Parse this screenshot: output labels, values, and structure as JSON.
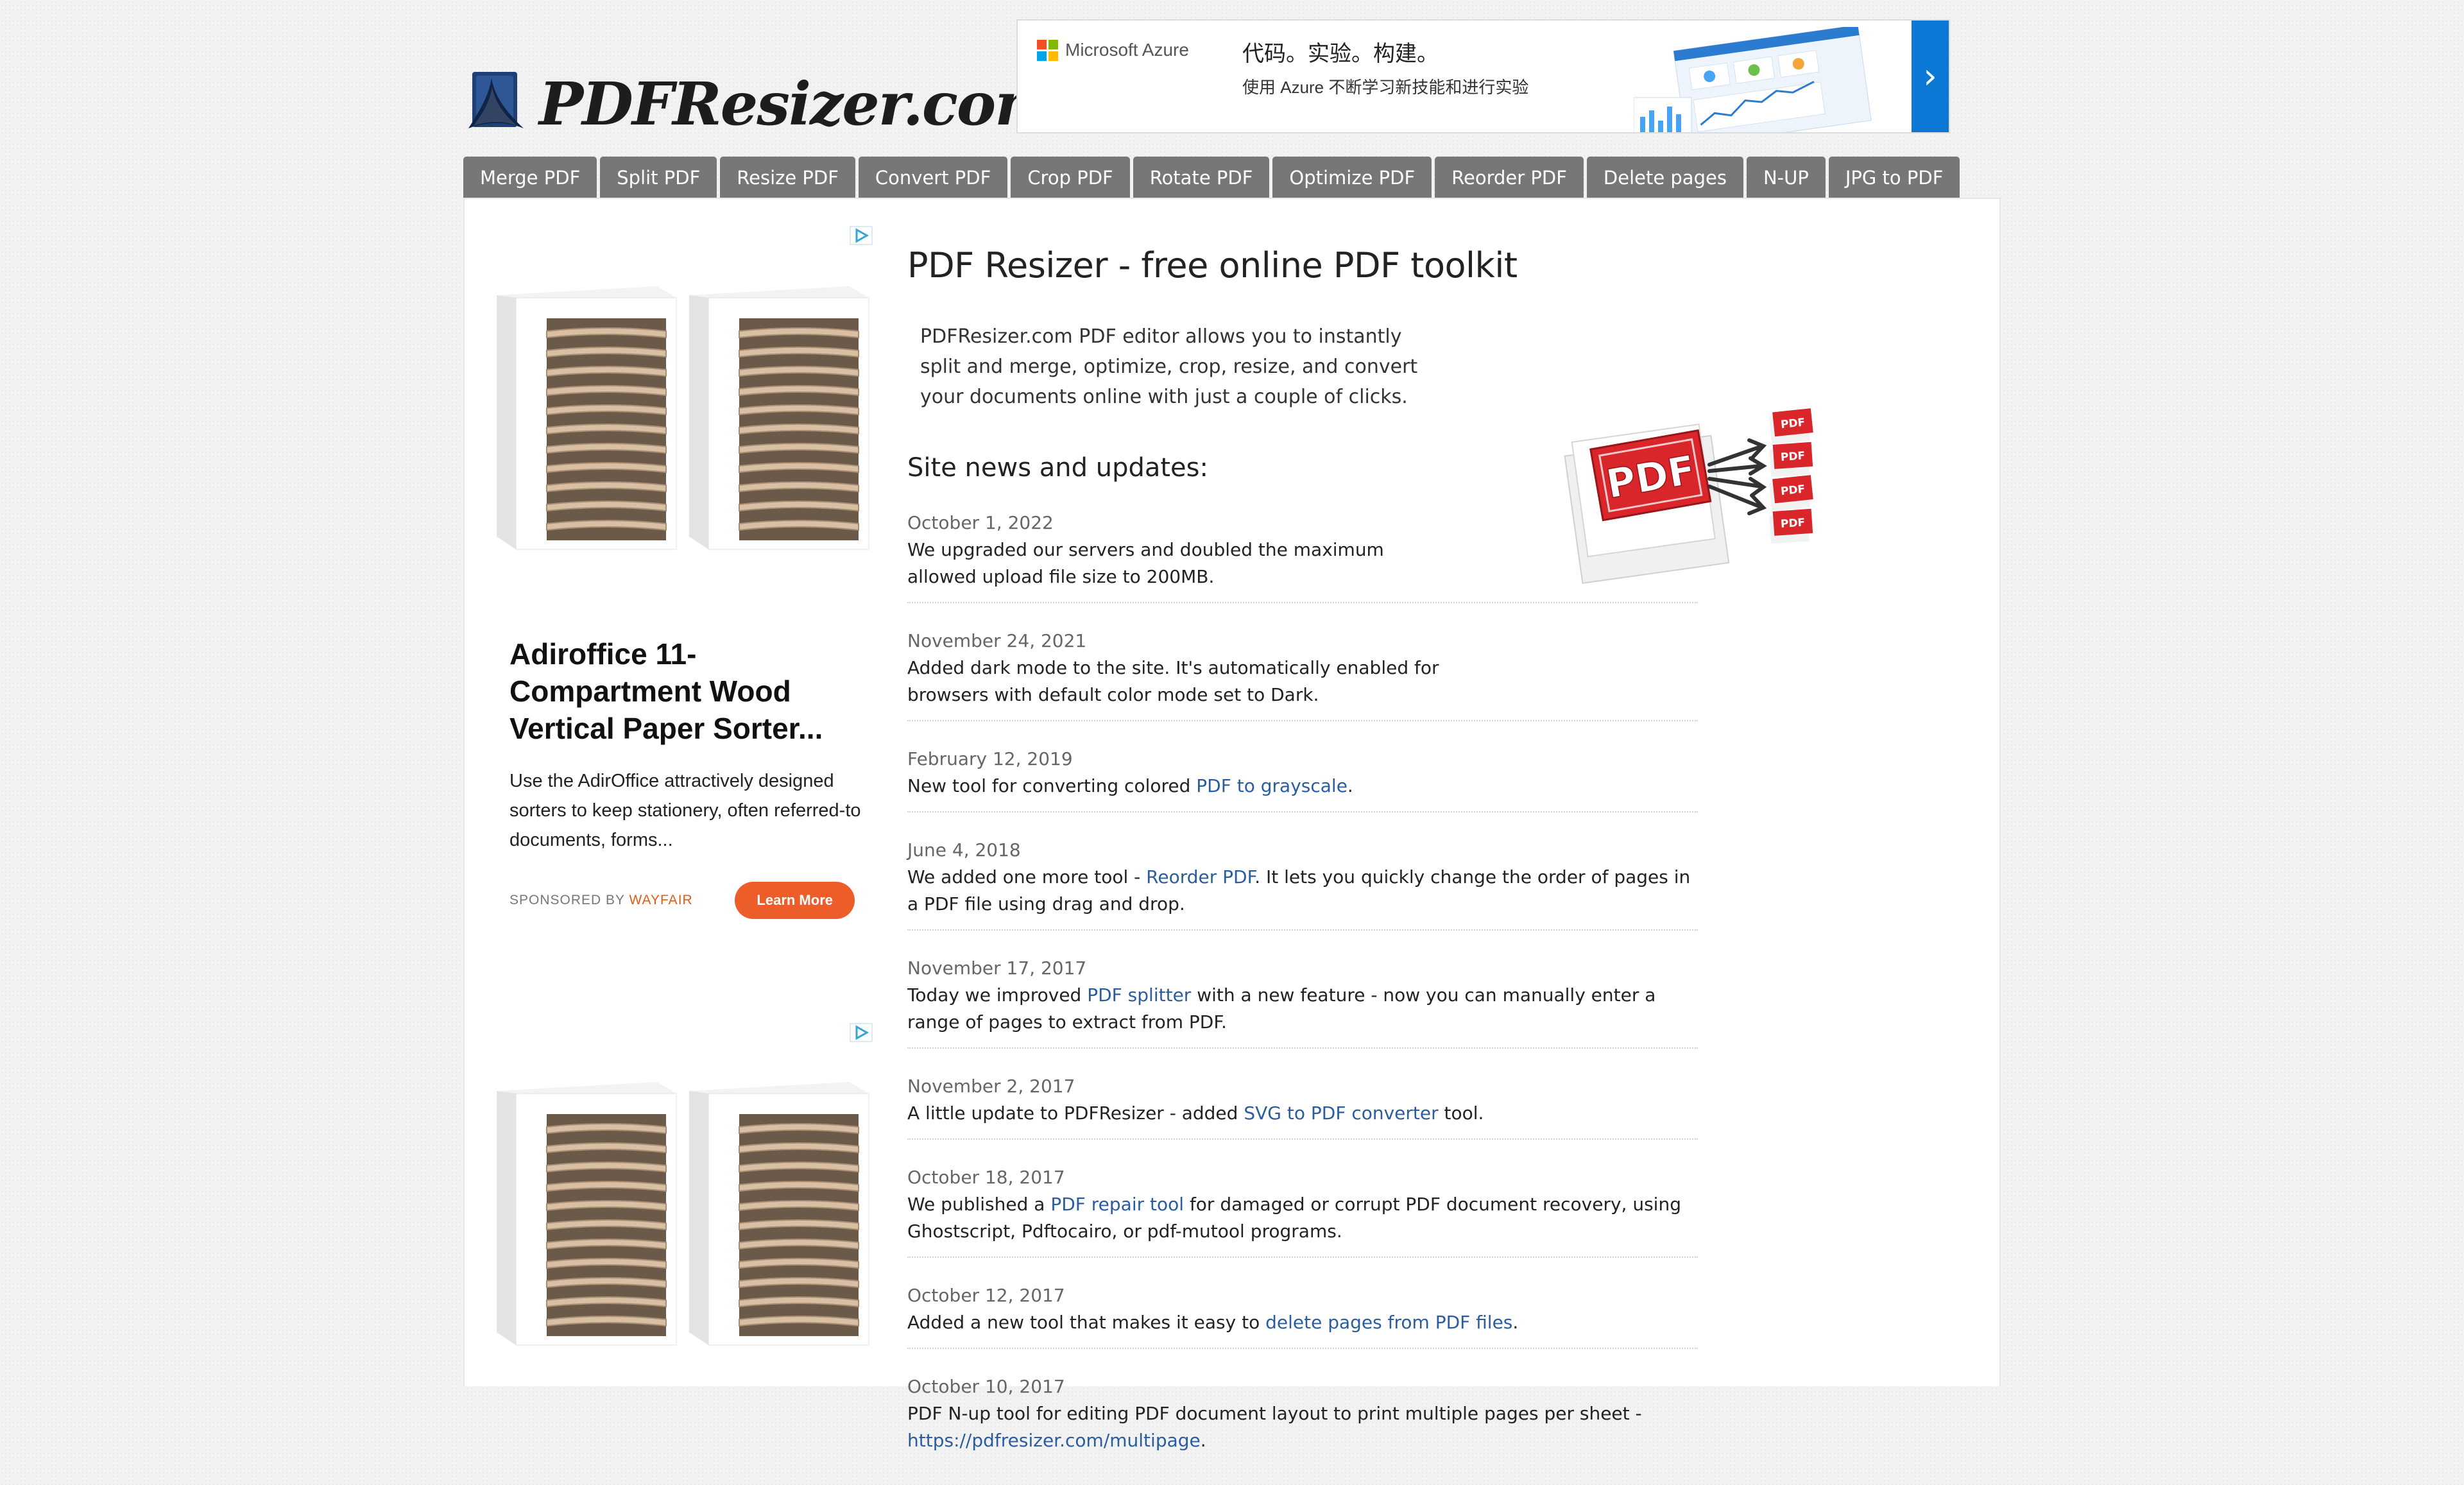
{
  "site": {
    "logo_text": "PDFResizer.com"
  },
  "banner_ad": {
    "brand": "Microsoft Azure",
    "headline": "代码。实验。构建。",
    "subline": "使用 Azure 不断学习新技能和进行实验",
    "arrow": "›"
  },
  "nav": {
    "tabs": [
      "Merge PDF",
      "Split PDF",
      "Resize PDF",
      "Convert PDF",
      "Crop PDF",
      "Rotate PDF",
      "Optimize PDF",
      "Reorder PDF",
      "Delete pages",
      "N-UP",
      "JPG to PDF"
    ]
  },
  "side_ad": {
    "title": "Adiroffice 11-Compartment Wood Vertical Paper Sorter...",
    "description": "Use the AdirOffice attractively designed sorters to keep stationery, often referred-to documents, forms...",
    "sponsored_by": "SPONSORED BY",
    "sponsor": "WAYFAIR",
    "cta": "Learn More"
  },
  "main": {
    "title": "PDF Resizer - free online PDF toolkit",
    "intro": "PDFResizer.com PDF editor allows you to instantly split and merge, optimize, crop, resize, and convert your documents online with just a couple of clicks.",
    "news_heading": "Site news and updates:",
    "news": [
      {
        "date": "October 1, 2022",
        "pre": "We upgraded our servers and doubled the maximum allowed upload file size to 200MB.",
        "link": "",
        "post": ""
      },
      {
        "date": "November 24, 2021",
        "pre": "Added dark mode to the site. It's automatically enabled for browsers with default color mode set to Dark.",
        "link": "",
        "post": ""
      },
      {
        "date": "February 12, 2019",
        "pre": "New tool for converting colored ",
        "link": "PDF to grayscale",
        "post": "."
      },
      {
        "date": "June 4, 2018",
        "pre": "We added one more tool - ",
        "link": "Reorder PDF",
        "post": ". It lets you quickly change the order of pages in a PDF file using drag and drop."
      },
      {
        "date": "November 17, 2017",
        "pre": "Today we improved ",
        "link": "PDF splitter",
        "post": " with a new feature - now you can manually enter a range of pages to extract from PDF."
      },
      {
        "date": "November 2, 2017",
        "pre": "A little update to PDFResizer - added ",
        "link": "SVG to PDF converter",
        "post": " tool."
      },
      {
        "date": "October 18, 2017",
        "pre": "We published a ",
        "link": "PDF repair tool",
        "post": " for damaged or corrupt PDF document recovery, using Ghostscript, Pdftocairo, or pdf-mutool programs."
      },
      {
        "date": "October 12, 2017",
        "pre": "Added a new tool that makes it easy to ",
        "link": "delete pages from PDF files",
        "post": "."
      },
      {
        "date": "October 10, 2017",
        "pre": "PDF N-up tool for editing PDF document layout to print multiple pages per sheet - ",
        "link": "https://pdfresizer.com/multipage",
        "post": "."
      }
    ],
    "hero_image": {
      "big_label": "PDF",
      "small_label": "PDF"
    }
  },
  "colors": {
    "nav_bg": "#777777",
    "link": "#2a5d9f",
    "cta": "#ec5d2a",
    "azure_blue": "#0a78d4",
    "pdf_red": "#d8262b"
  },
  "icons": [
    "adobe-pdf-logo-icon",
    "adchoices-icon",
    "chevron-right-icon"
  ]
}
